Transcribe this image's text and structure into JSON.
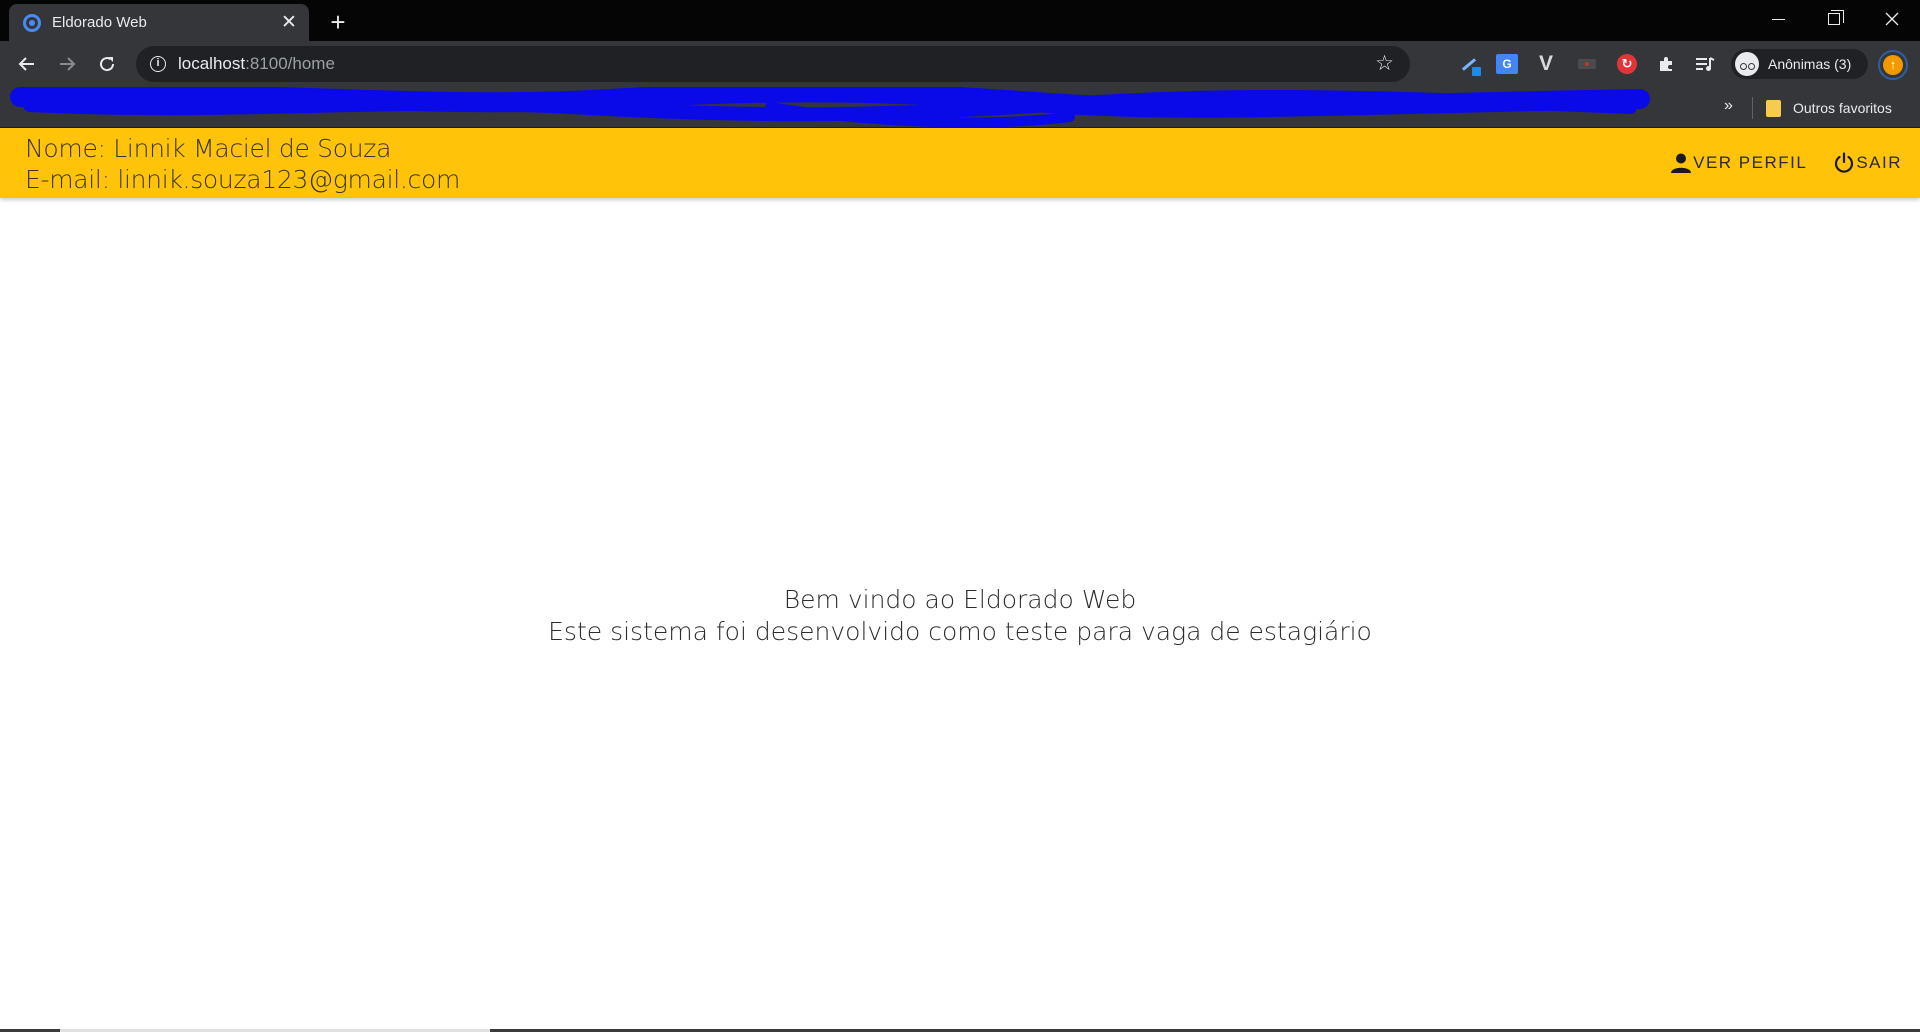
{
  "browser": {
    "tab_title": "Eldorado Web",
    "tab_close": "✕",
    "new_tab": "+",
    "url_host": "localhost",
    "url_path": ":8100/home",
    "profile_label": "Anônimas (3)",
    "bookmarks_more": "»",
    "bookmark_folder": "Outros favoritos"
  },
  "header": {
    "name_line": "Nome: Linnik Maciel de Souza",
    "email_line": "E-mail: linnik.souza123@gmail.com",
    "profile_button": "VER PERFIL",
    "logout_button": "SAIR",
    "background_color": "#ffc409"
  },
  "main": {
    "welcome_title": "Bem vindo ao Eldorado Web",
    "welcome_subtitle": "Este sistema foi desenvolvido como teste para vaga de estagiário"
  },
  "icons": {
    "tab_favicon": "ionic-icon",
    "back": "arrow-left-icon",
    "forward": "arrow-right-icon",
    "reload": "reload-icon",
    "site_info": "info-icon",
    "bookmark_star": "star-icon",
    "profile": "person-icon",
    "logout": "power-icon"
  }
}
